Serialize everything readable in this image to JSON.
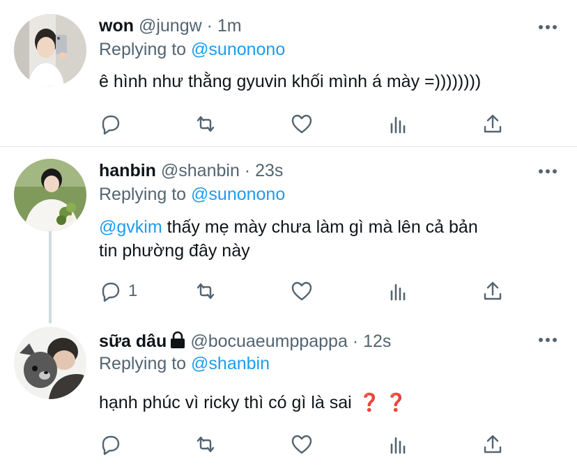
{
  "tweets": [
    {
      "name": "won",
      "handle": "@jungw",
      "time": "1m",
      "replying_prefix": "Replying to ",
      "replying_handle": "@sunonono",
      "text": "ê hình như thằng gyuvin khối mình á mày =))))))))",
      "reply_count": "",
      "avatar": "selfie-avatar"
    },
    {
      "name": "hanbin",
      "handle": "@shanbin",
      "time": "23s",
      "replying_prefix": "Replying to ",
      "replying_handle": "@sunonono",
      "mention": "@gvkim",
      "text_part1": " thấy mẹ mày chưa làm gì mà lên cả bản",
      "text_part2": "tin phường đây này",
      "reply_count": "1",
      "avatar": "bouquet-avatar"
    },
    {
      "name": "sữa dâu",
      "handle": "@bocuaeumppappa",
      "time": "12s",
      "replying_prefix": "Replying to ",
      "replying_handle": "@shanbin",
      "text": "hạnh phúc vì ricky thì có gì là sai",
      "emoji": "❓ ❓",
      "reply_count": "",
      "avatar": "dog-avatar",
      "protected": true
    }
  ],
  "separator": " · ",
  "icons": [
    "reply-icon",
    "retweet-icon",
    "like-icon",
    "views-icon",
    "share-icon",
    "more-icon",
    "lock-icon"
  ]
}
